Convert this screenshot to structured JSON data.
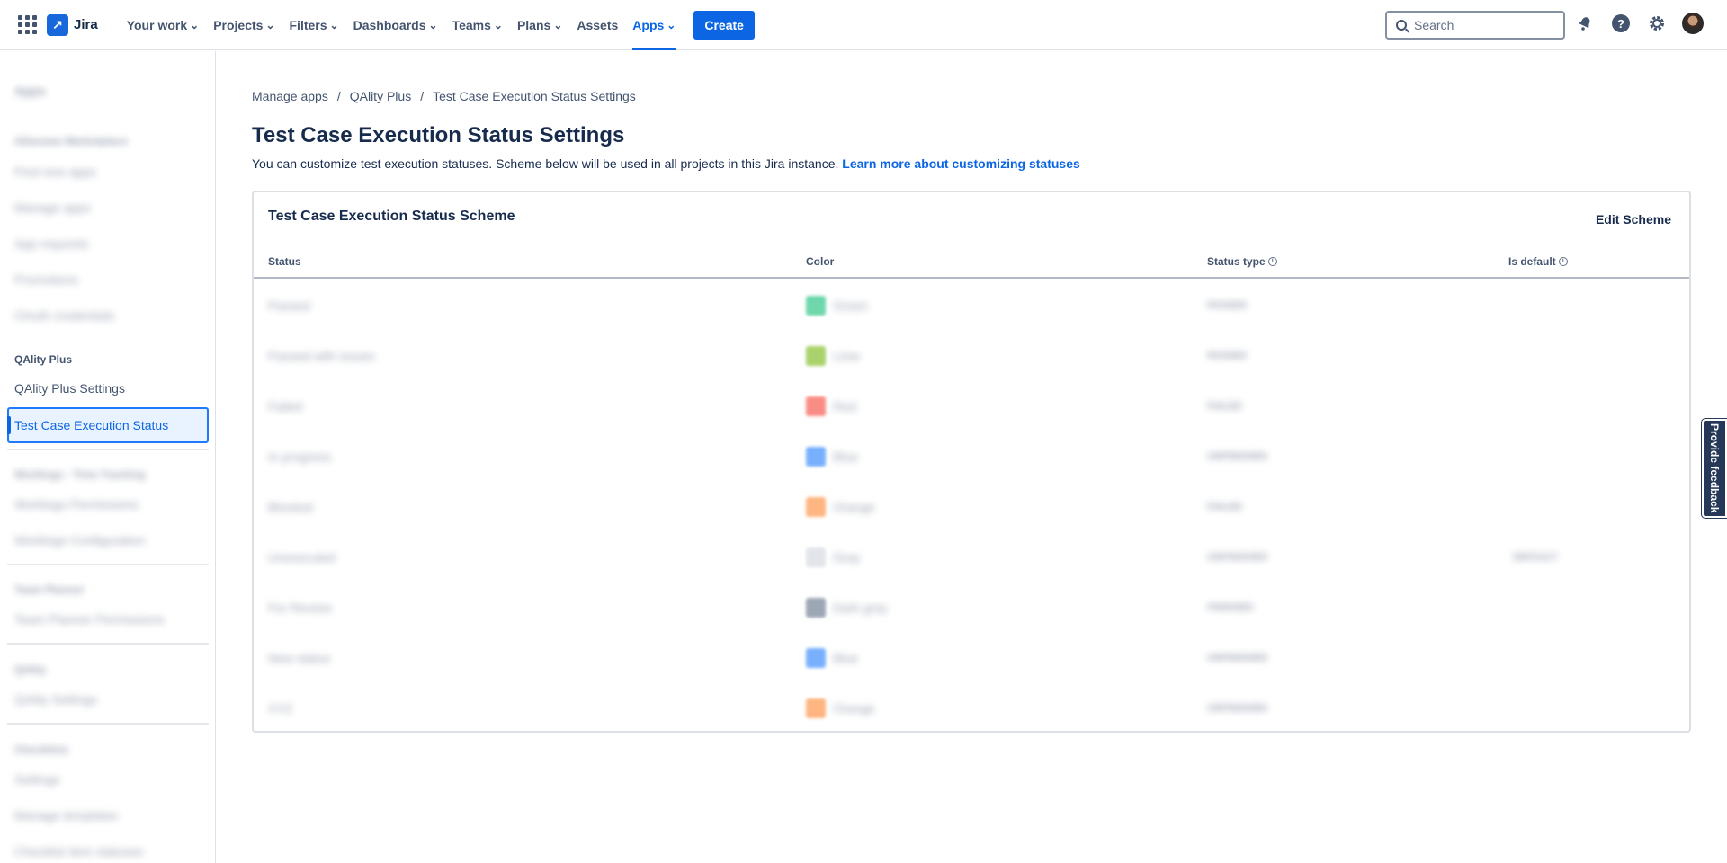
{
  "topnav": {
    "logo_text": "Jira",
    "items": [
      {
        "label": "Your work",
        "chevron": true
      },
      {
        "label": "Projects",
        "chevron": true
      },
      {
        "label": "Filters",
        "chevron": true
      },
      {
        "label": "Dashboards",
        "chevron": true
      },
      {
        "label": "Teams",
        "chevron": true
      },
      {
        "label": "Plans",
        "chevron": true
      },
      {
        "label": "Assets",
        "chevron": false
      },
      {
        "label": "Apps",
        "chevron": true,
        "active": true
      }
    ],
    "create_label": "Create",
    "search_placeholder": "Search",
    "icons": [
      "notifications-icon",
      "help-icon",
      "settings-icon",
      "avatar"
    ]
  },
  "sidebar": {
    "title": "Apps",
    "sections": [
      {
        "heading": "Atlassian Marketplace",
        "items": [
          "Find new apps",
          "Manage apps",
          "App requests",
          "Promotions",
          "OAuth credentials"
        ]
      },
      {
        "heading": "QAlity Plus",
        "items": [
          "QAlity Plus Settings",
          "Test Case Execution Status"
        ],
        "active_item": "Test Case Execution Status"
      },
      {
        "heading": "Worklogs - Time Tracking",
        "items": [
          "Worklogs Permissions",
          "Worklogs Configuration"
        ]
      },
      {
        "heading": "Team Planner",
        "items": [
          "Team Planner Permissions"
        ]
      },
      {
        "heading": "QAlity",
        "items": [
          "QAlity Settings"
        ]
      },
      {
        "heading": "Checklists",
        "items": [
          "Settings",
          "Manage templates",
          "Checklist item statuses"
        ]
      }
    ]
  },
  "breadcrumb": [
    "Manage apps",
    "QAlity Plus",
    "Test Case Execution Status Settings"
  ],
  "page": {
    "title": "Test Case Execution Status Settings",
    "description": "You can customize test execution statuses. Scheme below will be used in all projects in this Jira instance.",
    "learn_more": "Learn more about customizing statuses"
  },
  "scheme": {
    "title": "Test Case Execution Status Scheme",
    "edit_label": "Edit Scheme",
    "columns": [
      "Status",
      "Color",
      "Status type",
      "Is default"
    ],
    "rows": [
      {
        "status": "Passed",
        "color_name": "Green",
        "color": "#4bce97",
        "type": "PASSED",
        "default": ""
      },
      {
        "status": "Passed with issues",
        "color_name": "Lime",
        "color": "#94c748",
        "type": "PASSED",
        "default": ""
      },
      {
        "status": "Failed",
        "color_name": "Red",
        "color": "#f87168",
        "type": "FAILED",
        "default": ""
      },
      {
        "status": "In progress",
        "color_name": "Blue",
        "color": "#579dff",
        "type": "UNFINISHED",
        "default": ""
      },
      {
        "status": "Blocked",
        "color_name": "Orange",
        "color": "#fea362",
        "type": "FAILED",
        "default": ""
      },
      {
        "status": "Unexecuted",
        "color_name": "Gray",
        "color": "#dcdfe4",
        "type": "UNFINISHED",
        "default": "DEFAULT"
      },
      {
        "status": "For Review",
        "color_name": "Dark gray",
        "color": "#8590a2",
        "type": "FINISHED",
        "default": ""
      },
      {
        "status": "New status",
        "color_name": "Blue",
        "color": "#579dff",
        "type": "UNFINISHED",
        "default": ""
      },
      {
        "status": "XYZ",
        "color_name": "Orange",
        "color": "#fea362",
        "type": "UNFINISHED",
        "default": ""
      }
    ]
  },
  "feedback_label": "Provide feedback"
}
